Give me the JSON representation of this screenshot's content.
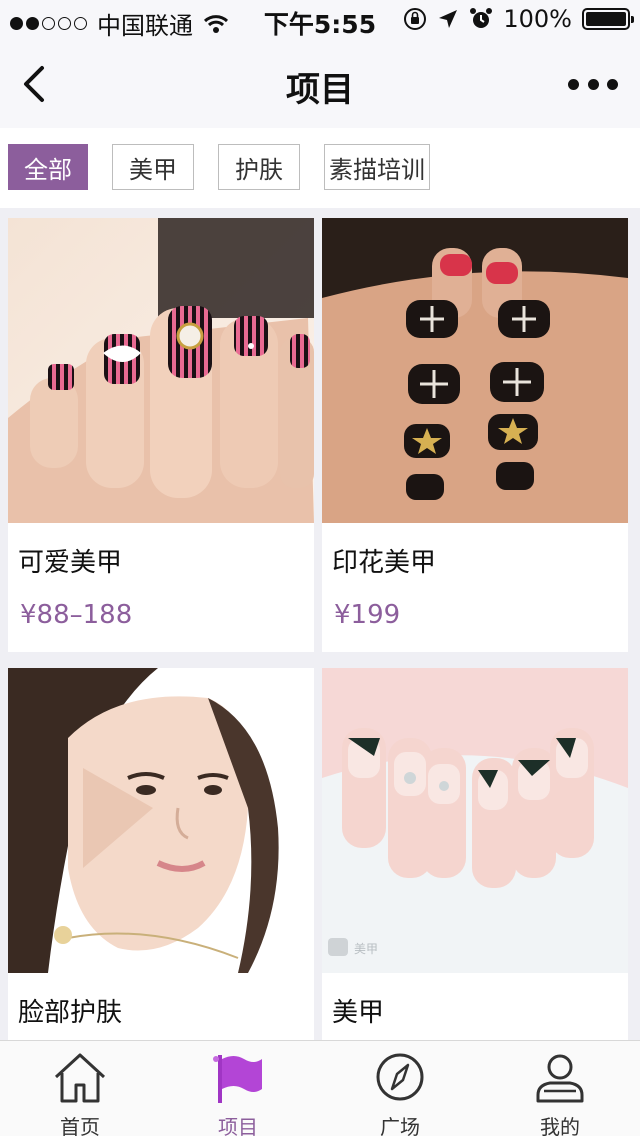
{
  "status_bar": {
    "carrier": "中国联通",
    "time": "下午5:55",
    "battery": "100%",
    "signal_icon": "signal-dots-icon",
    "wifi_icon": "wifi-icon"
  },
  "navbar": {
    "title": "项目",
    "back_icon": "chevron-left-icon",
    "more_icon": "more-dots-icon"
  },
  "filters": [
    {
      "label": "全部",
      "active": true
    },
    {
      "label": "美甲",
      "active": false
    },
    {
      "label": "护肤",
      "active": false
    },
    {
      "label": "素描培训",
      "active": false
    }
  ],
  "products": [
    {
      "name": "可爱美甲",
      "price": "¥88–188",
      "image": "pink-striped-nails-photo"
    },
    {
      "name": "印花美甲",
      "price": "¥199",
      "image": "black-printed-nails-photo"
    },
    {
      "name": "脸部护肤",
      "price": "",
      "image": "woman-face-skincare-photo"
    },
    {
      "name": "美甲",
      "price": "",
      "image": "pastel-french-nails-photo"
    }
  ],
  "tabbar": [
    {
      "label": "首页",
      "icon": "home-icon",
      "active": false
    },
    {
      "label": "项目",
      "icon": "flag-icon",
      "active": true
    },
    {
      "label": "广场",
      "icon": "compass-icon",
      "active": false
    },
    {
      "label": "我的",
      "icon": "user-icon",
      "active": false
    }
  ],
  "colors": {
    "accent": "#8c5e9c",
    "background": "#efeff4",
    "bar": "#f7f7fa"
  }
}
